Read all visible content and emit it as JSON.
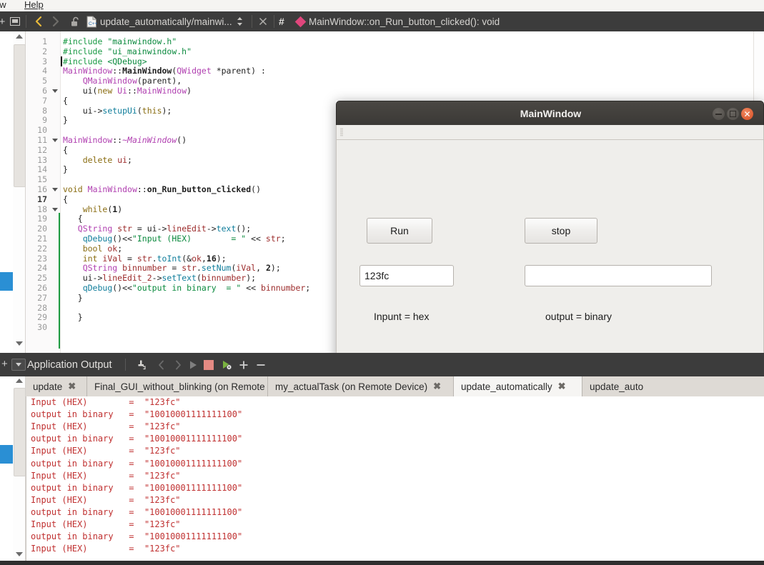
{
  "menu": {
    "window_label": "ow",
    "help_label": "Help"
  },
  "toolbar": {
    "back_icon": "chevron-left-icon",
    "forward_icon": "chevron-right-icon",
    "lock_icon": "unlock-icon",
    "file_icon": "cpp-file-icon",
    "file_name": "update_automatically/mainwi...",
    "updown_icon": "updown-arrows-icon",
    "close_icon": "close-icon",
    "hash_icon": "#",
    "symbol_icon": "diamond-icon",
    "symbol_name": "MainWindow::on_Run_button_clicked(): void",
    "split_icon": "split-view-icon",
    "plus_icon": "+"
  },
  "editor": {
    "lines": [
      {
        "n": "1",
        "fold": false,
        "cursor": false,
        "tokens": [
          {
            "t": "#include ",
            "c": "s-pre"
          },
          {
            "t": "\"mainwindow.h\"",
            "c": "s-str"
          }
        ]
      },
      {
        "n": "2",
        "fold": false,
        "cursor": false,
        "tokens": [
          {
            "t": "#include ",
            "c": "s-pre"
          },
          {
            "t": "\"ui_mainwindow.h\"",
            "c": "s-str"
          }
        ]
      },
      {
        "n": "3",
        "fold": false,
        "cursor": true,
        "tokens": [
          {
            "t": "#include ",
            "c": "s-pre"
          },
          {
            "t": "<QDebug>",
            "c": "s-str"
          }
        ]
      },
      {
        "n": "4",
        "fold": false,
        "cursor": false,
        "tokens": [
          {
            "t": "MainWindow",
            "c": "s-cls"
          },
          {
            "t": "::",
            "c": "s-op"
          },
          {
            "t": "MainWindow",
            "c": "s-fn"
          },
          {
            "t": "(",
            "c": "s-op"
          },
          {
            "t": "QWidget",
            "c": "s-cls"
          },
          {
            "t": " *parent) :",
            "c": "s-op"
          }
        ]
      },
      {
        "n": "5",
        "fold": false,
        "cursor": false,
        "tokens": [
          {
            "t": "    ",
            "c": "s-op"
          },
          {
            "t": "QMainWindow",
            "c": "s-cls"
          },
          {
            "t": "(parent),",
            "c": "s-op"
          }
        ]
      },
      {
        "n": "6",
        "fold": true,
        "cursor": false,
        "tokens": [
          {
            "t": "    ui(",
            "c": "s-op"
          },
          {
            "t": "new",
            "c": "s-kw"
          },
          {
            "t": " ",
            "c": "s-op"
          },
          {
            "t": "Ui",
            "c": "s-cls"
          },
          {
            "t": "::",
            "c": "s-op"
          },
          {
            "t": "MainWindow",
            "c": "s-cls"
          },
          {
            "t": ")",
            "c": "s-op"
          }
        ]
      },
      {
        "n": "7",
        "fold": false,
        "cursor": false,
        "tokens": [
          {
            "t": "{",
            "c": "s-op"
          }
        ]
      },
      {
        "n": "8",
        "fold": false,
        "cursor": false,
        "tokens": [
          {
            "t": "    ui->",
            "c": "s-op"
          },
          {
            "t": "setupUi",
            "c": "s-mem"
          },
          {
            "t": "(",
            "c": "s-op"
          },
          {
            "t": "this",
            "c": "s-kw"
          },
          {
            "t": ");",
            "c": "s-op"
          }
        ]
      },
      {
        "n": "9",
        "fold": false,
        "cursor": false,
        "tokens": [
          {
            "t": "}",
            "c": "s-op"
          }
        ]
      },
      {
        "n": "10",
        "fold": false,
        "cursor": false,
        "tokens": []
      },
      {
        "n": "11",
        "fold": true,
        "cursor": false,
        "tokens": [
          {
            "t": "MainWindow",
            "c": "s-cls"
          },
          {
            "t": "::",
            "c": "s-op"
          },
          {
            "t": "~MainWindow",
            "c": "s-ital"
          },
          {
            "t": "()",
            "c": "s-op"
          }
        ]
      },
      {
        "n": "12",
        "fold": false,
        "cursor": false,
        "tokens": [
          {
            "t": "{",
            "c": "s-op"
          }
        ]
      },
      {
        "n": "13",
        "fold": false,
        "cursor": false,
        "tokens": [
          {
            "t": "    ",
            "c": "s-op"
          },
          {
            "t": "delete",
            "c": "s-kw"
          },
          {
            "t": " ",
            "c": "s-op"
          },
          {
            "t": "ui",
            "c": "s-var"
          },
          {
            "t": ";",
            "c": "s-op"
          }
        ]
      },
      {
        "n": "14",
        "fold": false,
        "cursor": false,
        "tokens": [
          {
            "t": "}",
            "c": "s-op"
          }
        ]
      },
      {
        "n": "15",
        "fold": false,
        "cursor": false,
        "tokens": []
      },
      {
        "n": "16",
        "fold": true,
        "cursor": false,
        "tokens": [
          {
            "t": "void",
            "c": "s-kw"
          },
          {
            "t": " ",
            "c": "s-op"
          },
          {
            "t": "MainWindow",
            "c": "s-cls"
          },
          {
            "t": "::",
            "c": "s-op"
          },
          {
            "t": "on_Run_button_clicked",
            "c": "s-fn"
          },
          {
            "t": "()",
            "c": "s-op"
          }
        ]
      },
      {
        "n": "17",
        "fold": false,
        "cursor": false,
        "tokens": [
          {
            "t": "{",
            "c": "s-op"
          }
        ]
      },
      {
        "n": "18",
        "fold": true,
        "cursor": false,
        "tokens": [
          {
            "t": "    ",
            "c": "s-op"
          },
          {
            "t": "while",
            "c": "s-kw"
          },
          {
            "t": "(",
            "c": "s-op"
          },
          {
            "t": "1",
            "c": "s-num"
          },
          {
            "t": ")",
            "c": "s-op"
          }
        ]
      },
      {
        "n": "19",
        "fold": false,
        "cursor": false,
        "tokens": [
          {
            "t": "   {",
            "c": "s-op"
          }
        ]
      },
      {
        "n": "20",
        "fold": false,
        "cursor": false,
        "tokens": [
          {
            "t": "   ",
            "c": "s-op"
          },
          {
            "t": "QString",
            "c": "s-cls"
          },
          {
            "t": " ",
            "c": "s-op"
          },
          {
            "t": "str",
            "c": "s-var"
          },
          {
            "t": " = ui->",
            "c": "s-op"
          },
          {
            "t": "lineEdit",
            "c": "s-var"
          },
          {
            "t": "->",
            "c": "s-op"
          },
          {
            "t": "text",
            "c": "s-mem"
          },
          {
            "t": "();",
            "c": "s-op"
          }
        ]
      },
      {
        "n": "21",
        "fold": false,
        "cursor": false,
        "tokens": [
          {
            "t": "    ",
            "c": "s-op"
          },
          {
            "t": "qDebug",
            "c": "s-mem"
          },
          {
            "t": "()<<",
            "c": "s-op"
          },
          {
            "t": "\"Input (HEX)        = \"",
            "c": "s-str"
          },
          {
            "t": " << ",
            "c": "s-op"
          },
          {
            "t": "str",
            "c": "s-var"
          },
          {
            "t": ";",
            "c": "s-op"
          }
        ]
      },
      {
        "n": "22",
        "fold": false,
        "cursor": false,
        "tokens": [
          {
            "t": "    ",
            "c": "s-op"
          },
          {
            "t": "bool",
            "c": "s-kw"
          },
          {
            "t": " ",
            "c": "s-op"
          },
          {
            "t": "ok",
            "c": "s-var"
          },
          {
            "t": ";",
            "c": "s-op"
          }
        ]
      },
      {
        "n": "23",
        "fold": false,
        "cursor": false,
        "tokens": [
          {
            "t": "    ",
            "c": "s-op"
          },
          {
            "t": "int",
            "c": "s-kw"
          },
          {
            "t": " ",
            "c": "s-op"
          },
          {
            "t": "iVal",
            "c": "s-var"
          },
          {
            "t": " = ",
            "c": "s-op"
          },
          {
            "t": "str",
            "c": "s-var"
          },
          {
            "t": ".",
            "c": "s-op"
          },
          {
            "t": "toInt",
            "c": "s-mem"
          },
          {
            "t": "(&",
            "c": "s-op"
          },
          {
            "t": "ok",
            "c": "s-var"
          },
          {
            "t": ",",
            "c": "s-op"
          },
          {
            "t": "16",
            "c": "s-num"
          },
          {
            "t": ");",
            "c": "s-op"
          }
        ]
      },
      {
        "n": "24",
        "fold": false,
        "cursor": false,
        "tokens": [
          {
            "t": "    ",
            "c": "s-op"
          },
          {
            "t": "QString",
            "c": "s-cls"
          },
          {
            "t": " ",
            "c": "s-op"
          },
          {
            "t": "binnumber",
            "c": "s-var"
          },
          {
            "t": " = ",
            "c": "s-op"
          },
          {
            "t": "str",
            "c": "s-var"
          },
          {
            "t": ".",
            "c": "s-op"
          },
          {
            "t": "setNum",
            "c": "s-mem"
          },
          {
            "t": "(",
            "c": "s-op"
          },
          {
            "t": "iVal",
            "c": "s-var"
          },
          {
            "t": ", ",
            "c": "s-op"
          },
          {
            "t": "2",
            "c": "s-num"
          },
          {
            "t": ");",
            "c": "s-op"
          }
        ]
      },
      {
        "n": "25",
        "fold": false,
        "cursor": false,
        "tokens": [
          {
            "t": "    ui->",
            "c": "s-op"
          },
          {
            "t": "lineEdit_2",
            "c": "s-var"
          },
          {
            "t": "->",
            "c": "s-op"
          },
          {
            "t": "setText",
            "c": "s-mem"
          },
          {
            "t": "(",
            "c": "s-op"
          },
          {
            "t": "binnumber",
            "c": "s-var"
          },
          {
            "t": ");",
            "c": "s-op"
          }
        ]
      },
      {
        "n": "26",
        "fold": false,
        "cursor": false,
        "tokens": [
          {
            "t": "    ",
            "c": "s-op"
          },
          {
            "t": "qDebug",
            "c": "s-mem"
          },
          {
            "t": "()<<",
            "c": "s-op"
          },
          {
            "t": "\"output in binary  = \"",
            "c": "s-str"
          },
          {
            "t": " << ",
            "c": "s-op"
          },
          {
            "t": "binnumber",
            "c": "s-var"
          },
          {
            "t": ";",
            "c": "s-op"
          }
        ]
      },
      {
        "n": "27",
        "fold": false,
        "cursor": false,
        "tokens": [
          {
            "t": "   }",
            "c": "s-op"
          }
        ]
      },
      {
        "n": "28",
        "fold": false,
        "cursor": false,
        "tokens": []
      },
      {
        "n": "29",
        "fold": false,
        "cursor": false,
        "tokens": [
          {
            "t": "   }",
            "c": "s-op"
          }
        ]
      },
      {
        "n": "30",
        "fold": false,
        "cursor": false,
        "tokens": []
      }
    ],
    "current_line": "17"
  },
  "dialog": {
    "title": "MainWindow",
    "minimize_icon": "minimize-icon",
    "maximize_icon": "maximize-icon",
    "close_icon": "close-icon",
    "run_button": "Run",
    "stop_button": "stop",
    "input_value": "123fc",
    "output_value": "",
    "input_label": "Inpunt = hex",
    "output_label": "output = binary"
  },
  "app_output": {
    "title": "Application Output",
    "icons": [
      {
        "name": "attach-debugger-icon",
        "glyph": "⚑"
      },
      {
        "name": "prev-item-icon",
        "glyph": "‹"
      },
      {
        "name": "next-item-icon",
        "glyph": "›"
      },
      {
        "name": "run-icon",
        "glyph": "▶"
      },
      {
        "name": "stop-icon",
        "glyph": "■"
      },
      {
        "name": "run-settings-icon",
        "glyph": "▶"
      },
      {
        "name": "maximize-pane-icon",
        "glyph": "+"
      },
      {
        "name": "close-pane-icon",
        "glyph": "−"
      }
    ],
    "tabs": [
      {
        "label": "update",
        "active": false,
        "close_icon": "✖"
      },
      {
        "label": "Final_GUI_without_blinking (on Remote Device)",
        "active": false,
        "close_icon": "✖"
      },
      {
        "label": "my_actualTask (on Remote Device)",
        "active": false,
        "close_icon": "✖"
      },
      {
        "label": "update_automatically",
        "active": true,
        "close_icon": "✖"
      },
      {
        "label": "update_auto",
        "active": false,
        "close_icon": ""
      }
    ],
    "log_lines": [
      "Input (HEX)        =  \"123fc\"",
      "output in binary   =  \"10010001111111100\"",
      "Input (HEX)        =  \"123fc\"",
      "output in binary   =  \"10010001111111100\"",
      "Input (HEX)        =  \"123fc\"",
      "output in binary   =  \"10010001111111100\"",
      "Input (HEX)        =  \"123fc\"",
      "output in binary   =  \"10010001111111100\"",
      "Input (HEX)        =  \"123fc\"",
      "output in binary   =  \"10010001111111100\"",
      "Input (HEX)        =  \"123fc\"",
      "output in binary   =  \"10010001111111100\"",
      "Input (HEX)        =  \"123fc\""
    ]
  },
  "colors": {
    "toolbar_bg": "#3c3c3c",
    "symbol_accent": "#e0467c",
    "log_text": "#c03131",
    "close_button": "#d64b20",
    "selection_blue": "#2a8fd4"
  }
}
